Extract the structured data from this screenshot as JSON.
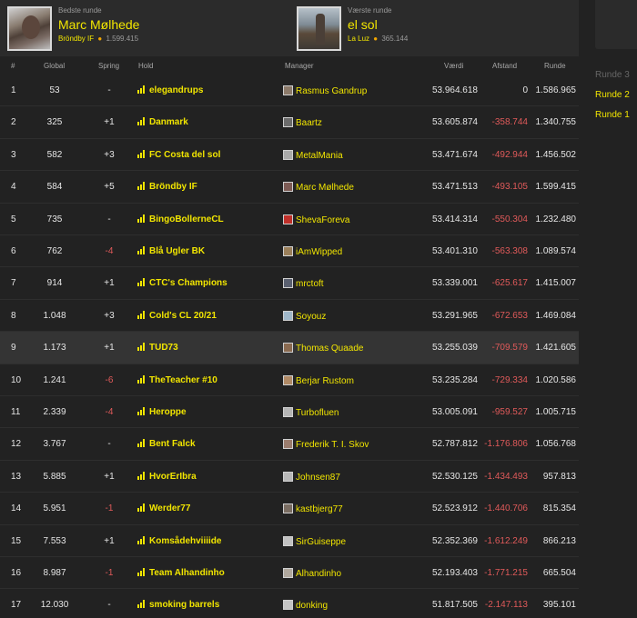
{
  "best": {
    "label": "Bedste runde",
    "name": "Marc Mølhede",
    "team": "Bröndby IF",
    "points": "1.599.415"
  },
  "worst": {
    "label": "Værste runde",
    "name": "el sol",
    "team": "La Luz",
    "points": "365.144"
  },
  "rounds": [
    "Runde 3",
    "Runde 2",
    "Runde 1"
  ],
  "columns": {
    "rank": "#",
    "global": "Global",
    "spring": "Spring",
    "team": "Hold",
    "manager": "Manager",
    "value": "Værdi",
    "distance": "Afstand",
    "round": "Runde"
  },
  "rows": [
    {
      "rank": "1",
      "global": "53",
      "spring": "-",
      "team": "elegandrups",
      "manager": "Rasmus Gandrup",
      "value": "53.964.618",
      "distance": "0",
      "round": "1.586.965"
    },
    {
      "rank": "2",
      "global": "325",
      "spring": "+1",
      "team": "Danmark",
      "manager": "Baartz",
      "value": "53.605.874",
      "distance": "-358.744",
      "round": "1.340.755"
    },
    {
      "rank": "3",
      "global": "582",
      "spring": "+3",
      "team": "FC Costa del sol",
      "manager": "MetalMania",
      "value": "53.471.674",
      "distance": "-492.944",
      "round": "1.456.502"
    },
    {
      "rank": "4",
      "global": "584",
      "spring": "+5",
      "team": "Bröndby IF",
      "manager": "Marc Mølhede",
      "value": "53.471.513",
      "distance": "-493.105",
      "round": "1.599.415"
    },
    {
      "rank": "5",
      "global": "735",
      "spring": "-",
      "team": "BingoBollerneCL",
      "manager": "ShevaForeva",
      "value": "53.414.314",
      "distance": "-550.304",
      "round": "1.232.480"
    },
    {
      "rank": "6",
      "global": "762",
      "spring": "-4",
      "team": "Blå Ugler BK",
      "manager": "iAmWipped",
      "value": "53.401.310",
      "distance": "-563.308",
      "round": "1.089.574"
    },
    {
      "rank": "7",
      "global": "914",
      "spring": "+1",
      "team": "CTC's Champions",
      "manager": "mrctoft",
      "value": "53.339.001",
      "distance": "-625.617",
      "round": "1.415.007"
    },
    {
      "rank": "8",
      "global": "1.048",
      "spring": "+3",
      "team": "Cold's CL 20/21",
      "manager": "Soyouz",
      "value": "53.291.965",
      "distance": "-672.653",
      "round": "1.469.084"
    },
    {
      "rank": "9",
      "global": "1.173",
      "spring": "+1",
      "team": "TUD73",
      "manager": "Thomas Quaade",
      "value": "53.255.039",
      "distance": "-709.579",
      "round": "1.421.605"
    },
    {
      "rank": "10",
      "global": "1.241",
      "spring": "-6",
      "team": "TheTeacher #10",
      "manager": "Berjar Rustom",
      "value": "53.235.284",
      "distance": "-729.334",
      "round": "1.020.586"
    },
    {
      "rank": "11",
      "global": "2.339",
      "spring": "-4",
      "team": "Heroppe",
      "manager": "Turbofluen",
      "value": "53.005.091",
      "distance": "-959.527",
      "round": "1.005.715"
    },
    {
      "rank": "12",
      "global": "3.767",
      "spring": "-",
      "team": "Bent Falck",
      "manager": "Frederik T. I. Skov",
      "value": "52.787.812",
      "distance": "-1.176.806",
      "round": "1.056.768"
    },
    {
      "rank": "13",
      "global": "5.885",
      "spring": "+1",
      "team": "HvorErIbra",
      "manager": "Johnsen87",
      "value": "52.530.125",
      "distance": "-1.434.493",
      "round": "957.813"
    },
    {
      "rank": "14",
      "global": "5.951",
      "spring": "-1",
      "team": "Werder77",
      "manager": "kastbjerg77",
      "value": "52.523.912",
      "distance": "-1.440.706",
      "round": "815.354"
    },
    {
      "rank": "15",
      "global": "7.553",
      "spring": "+1",
      "team": "Komsådehviiiide",
      "manager": "SirGuiseppe",
      "value": "52.352.369",
      "distance": "-1.612.249",
      "round": "866.213"
    },
    {
      "rank": "16",
      "global": "8.987",
      "spring": "-1",
      "team": "Team Alhandinho",
      "manager": "Alhandinho",
      "value": "52.193.403",
      "distance": "-1.771.215",
      "round": "665.504"
    },
    {
      "rank": "17",
      "global": "12.030",
      "spring": "-",
      "team": "smoking barrels",
      "manager": "donking",
      "value": "51.817.505",
      "distance": "-2.147.113",
      "round": "395.101"
    }
  ]
}
